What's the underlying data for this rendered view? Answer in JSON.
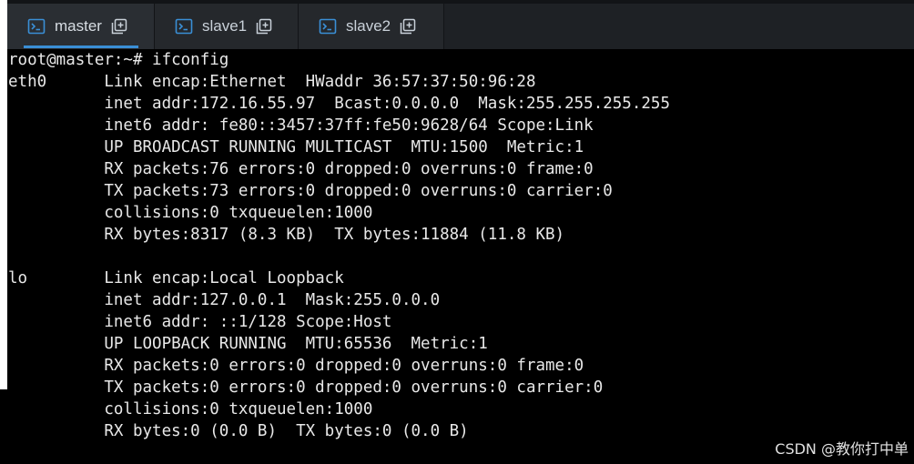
{
  "tabs": [
    {
      "label": "master",
      "active": true,
      "icon": "terminal-icon",
      "action_icon": "new-window-icon"
    },
    {
      "label": "slave1",
      "active": false,
      "icon": "terminal-icon",
      "action_icon": "new-window-icon"
    },
    {
      "label": "slave2",
      "active": false,
      "icon": "terminal-icon",
      "action_icon": "new-window-icon"
    }
  ],
  "colors": {
    "accent": "#3a8fd6",
    "terminal_bg": "#000000",
    "terminal_fg": "#e8e8e8",
    "tabbar_bg": "#1e2125"
  },
  "terminal": {
    "lines": [
      "root@master:~# ifconfig",
      "eth0      Link encap:Ethernet  HWaddr 36:57:37:50:96:28",
      "          inet addr:172.16.55.97  Bcast:0.0.0.0  Mask:255.255.255.255",
      "          inet6 addr: fe80::3457:37ff:fe50:9628/64 Scope:Link",
      "          UP BROADCAST RUNNING MULTICAST  MTU:1500  Metric:1",
      "          RX packets:76 errors:0 dropped:0 overruns:0 frame:0",
      "          TX packets:73 errors:0 dropped:0 overruns:0 carrier:0",
      "          collisions:0 txqueuelen:1000",
      "          RX bytes:8317 (8.3 KB)  TX bytes:11884 (11.8 KB)",
      "",
      "lo        Link encap:Local Loopback",
      "          inet addr:127.0.0.1  Mask:255.0.0.0",
      "          inet6 addr: ::1/128 Scope:Host",
      "          UP LOOPBACK RUNNING  MTU:65536  Metric:1",
      "          RX packets:0 errors:0 dropped:0 overruns:0 frame:0",
      "          TX packets:0 errors:0 dropped:0 overruns:0 carrier:0",
      "          collisions:0 txqueuelen:1000",
      "          RX bytes:0 (0.0 B)  TX bytes:0 (0.0 B)"
    ]
  },
  "watermark": "CSDN @教你打中单"
}
